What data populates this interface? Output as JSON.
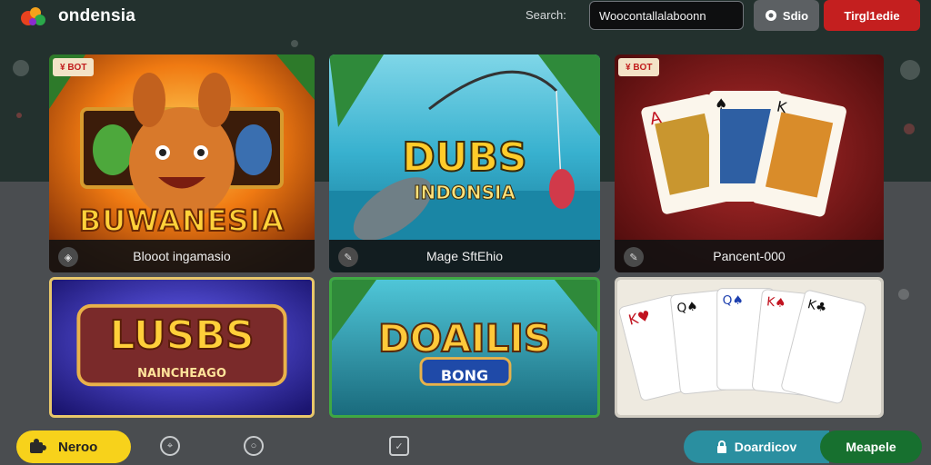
{
  "header": {
    "brand": "ondensia",
    "search_label": "Search:",
    "search_value": "Woocontallalaboonn",
    "sub_button": "Sdio",
    "register_button": "Tirgl1edie"
  },
  "cards": [
    {
      "tag": "¥ BOT",
      "art_title": "BUWANESIA",
      "caption": "Blooot ingamasio",
      "icon": "tag-icon"
    },
    {
      "tag": "",
      "art_title": "DUBS",
      "art_subtitle": "INDONSIA",
      "caption": "Mage SftEhio",
      "icon": "edit-icon"
    },
    {
      "tag": "¥ BOT",
      "art_title": "",
      "caption": "Pancent-000",
      "icon": "edit-icon"
    },
    {
      "tag": "",
      "art_title": "LUSBS",
      "art_subtitle": "NAINCHEAGO",
      "caption": "",
      "icon": ""
    },
    {
      "tag": "",
      "art_title": "DOAILIS",
      "art_subtitle": "BONG",
      "caption": "",
      "icon": ""
    },
    {
      "tag": "",
      "art_title": "",
      "caption": "",
      "icon": ""
    }
  ],
  "bottom": {
    "new_label": "Neroo",
    "download_label": "Doardicov",
    "manage_label": "Meapele"
  },
  "colors": {
    "register": "#c41f1f",
    "new": "#f7d21b",
    "download": "#2a8fa0",
    "manage": "#17702f"
  }
}
